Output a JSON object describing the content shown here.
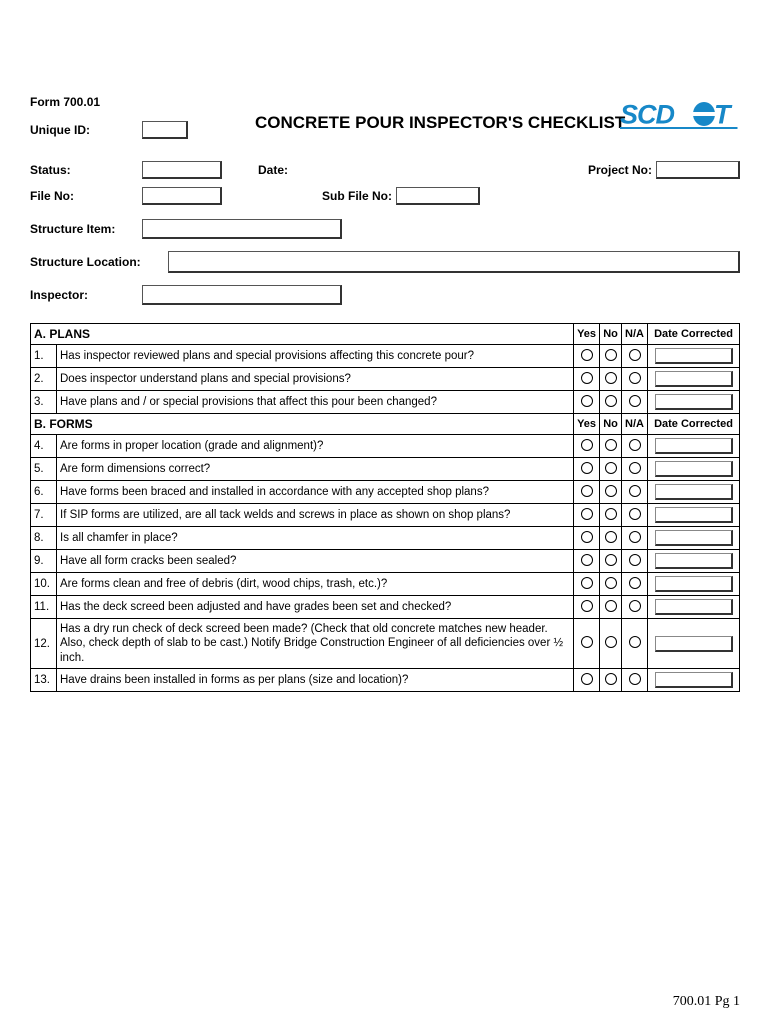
{
  "form_no": "Form 700.01",
  "title": "CONCRETE POUR INSPECTOR'S CHECKLIST",
  "logo_text": "SCDOT",
  "labels": {
    "unique_id": "Unique ID:",
    "status": "Status:",
    "date": "Date:",
    "project_no": "Project No:",
    "file_no": "File No:",
    "sub_file_no": "Sub File No:",
    "structure_item": "Structure Item:",
    "structure_location": "Structure Location:",
    "inspector": "Inspector:"
  },
  "cols": {
    "yes": "Yes",
    "no": "No",
    "na": "N/A",
    "date_corrected": "Date Corrected"
  },
  "sections": [
    {
      "heading": "A. PLANS",
      "rows": [
        {
          "n": "1.",
          "q": "Has inspector reviewed plans and special provisions affecting this concrete pour?"
        },
        {
          "n": "2.",
          "q": "Does inspector understand plans and special provisions?"
        },
        {
          "n": "3.",
          "q": "Have plans and / or special provisions that affect this pour been changed?"
        }
      ]
    },
    {
      "heading": "B. FORMS",
      "rows": [
        {
          "n": "4.",
          "q": "Are forms in proper location (grade and alignment)?"
        },
        {
          "n": "5.",
          "q": "Are form dimensions correct?"
        },
        {
          "n": "6.",
          "q": "Have forms been braced and installed in accordance with any accepted shop plans?"
        },
        {
          "n": "7.",
          "q": "If SIP forms are utilized, are all tack welds and screws in place as shown on shop plans?"
        },
        {
          "n": "8.",
          "q": "Is all chamfer in place?"
        },
        {
          "n": "9.",
          "q": "Have all form cracks been sealed?"
        },
        {
          "n": "10.",
          "q": "Are forms clean and free of debris (dirt, wood chips, trash, etc.)?"
        },
        {
          "n": "11.",
          "q": "Has the deck screed been adjusted and have grades been set and checked?"
        },
        {
          "n": "12.",
          "q": "Has a dry run check of deck screed been made? (Check that old concrete matches new header. Also, check depth of slab to be cast.) Notify Bridge Construction Engineer of all deficiencies over ½ inch.",
          "tall": true
        },
        {
          "n": "13.",
          "q": "Have drains been installed in forms as per plans (size and location)?"
        }
      ]
    }
  ],
  "footer": "700.01 Pg 1"
}
